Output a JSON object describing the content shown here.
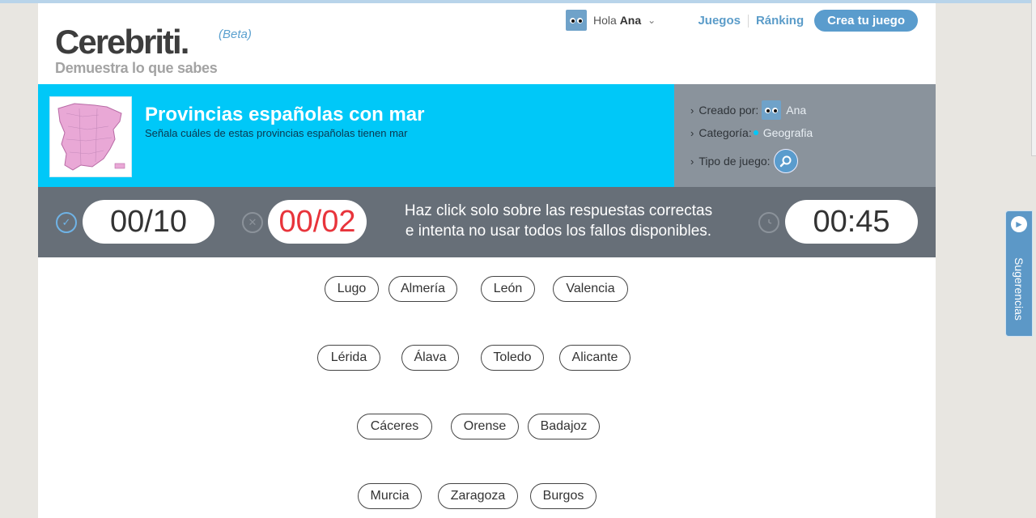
{
  "header": {
    "logo": "Cerebriti.",
    "beta": "(Beta)",
    "tagline": "Demuestra lo que sabes",
    "hola": "Hola",
    "username": "Ana",
    "nav": [
      {
        "label": "Juegos"
      },
      {
        "label": "Ránking"
      },
      {
        "label": "Crea tu juego"
      }
    ]
  },
  "game": {
    "title": "Provincias españolas con mar",
    "subtitle": "Señala cuáles de estas provincias españolas tienen mar",
    "created_by_label": "Creado por:",
    "created_by": "Ana",
    "category_label": "Categoría:",
    "category": "Geografia",
    "type_label": "Tipo de juego:"
  },
  "score": {
    "correct": "00/10",
    "errors": "00/02",
    "timer": "00:45",
    "instruction_line1": "Haz click solo sobre las respuestas correctas",
    "instruction_line2": "e intenta no usar todos los fallos disponibles."
  },
  "answers": [
    [
      "Lugo",
      "Almería",
      "León",
      "Valencia"
    ],
    [
      "Lérida",
      "Álava",
      "Toledo",
      "Alicante"
    ],
    [
      "Cáceres",
      "Orense",
      "Badajoz"
    ],
    [
      "Murcia",
      "Zaragoza",
      "Burgos"
    ]
  ],
  "side_tab": {
    "label": "Sugerencias"
  },
  "colors": {
    "banner": "#00c8f8",
    "meta": "#8a939c",
    "scorebar": "#676f78",
    "accent": "#5a9ccd",
    "errors": "#e8343b"
  }
}
